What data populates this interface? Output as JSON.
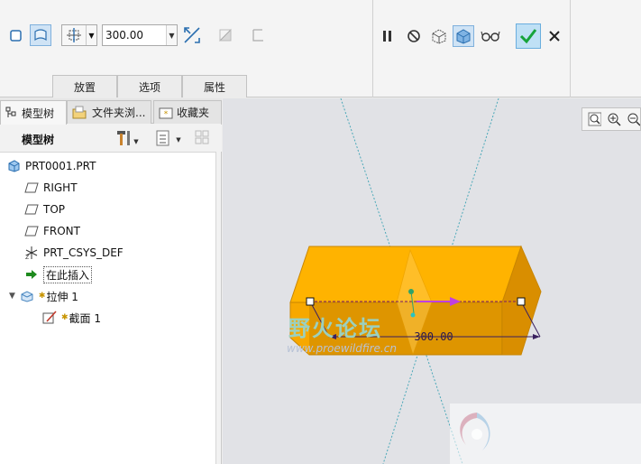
{
  "ribbon": {
    "depth_value": "300.00",
    "tabs": [
      "放置",
      "选项",
      "属性"
    ]
  },
  "panel": {
    "tabs": [
      "模型树",
      "文件夹浏...",
      "收藏夹"
    ],
    "tree_title": "模型树"
  },
  "tree": {
    "items": [
      {
        "label": "PRT0001.PRT",
        "icon": "part-icon"
      },
      {
        "label": "RIGHT",
        "icon": "datum-plane-icon"
      },
      {
        "label": "TOP",
        "icon": "datum-plane-icon"
      },
      {
        "label": "FRONT",
        "icon": "datum-plane-icon"
      },
      {
        "label": "PRT_CSYS_DEF",
        "icon": "csys-icon"
      },
      {
        "label": "在此插入",
        "icon": "insert-arrow-icon"
      },
      {
        "label": "拉伸 1",
        "icon": "extrude-icon"
      },
      {
        "label": "截面 1",
        "icon": "sketch-icon"
      }
    ]
  },
  "graphics": {
    "dimension_value": "300.00",
    "colors": {
      "solid_front": "#f7a800",
      "solid_top": "#ffb300",
      "solid_side": "#d98e00",
      "datum": "#4aa8b8",
      "accent": "#2ea36a"
    }
  },
  "watermark": {
    "title": "野火论坛",
    "url": "www.proewildfire.cn"
  }
}
